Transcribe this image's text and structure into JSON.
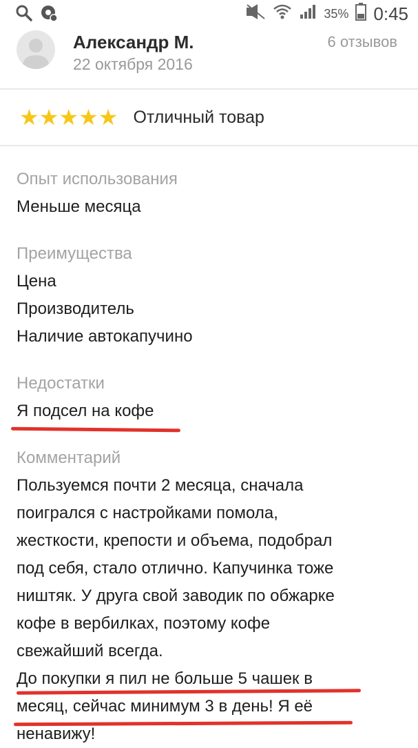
{
  "statusbar": {
    "battery_percent": "35%",
    "time": "0:45"
  },
  "review": {
    "author": "Александр М.",
    "date": "22 октября 2016",
    "reviews_count": "6 отзывов",
    "rating": 5,
    "title": "Отличный товар",
    "experience_label": "Опыт использования",
    "experience_value": "Меньше месяца",
    "pros_label": "Преимущества",
    "pros": [
      "Цена",
      "Производитель",
      "Наличие автокапучино"
    ],
    "cons_label": "Недостатки",
    "cons_value": "Я подсел на кофе",
    "comment_label": "Комментарий",
    "comment_lines": [
      "Пользуемся почти 2 месяца, сначала",
      "поигрался с настройками помола,",
      "жесткости, крепости и объема, подобрал",
      "под себя, стало отлично. Капучинка тоже",
      "ништяк. У друга свой заводик по обжарке",
      "кофе в вербилках, поэтому кофе",
      "свежайший всегда.",
      "До покупки я пил не больше 5 чашек в",
      "месяц, сейчас минимум 3 в день! Я её",
      "ненавижу!"
    ]
  },
  "colors": {
    "star": "#f7c718",
    "underline": "#e1322b",
    "label_gray": "#a3a3a3"
  }
}
